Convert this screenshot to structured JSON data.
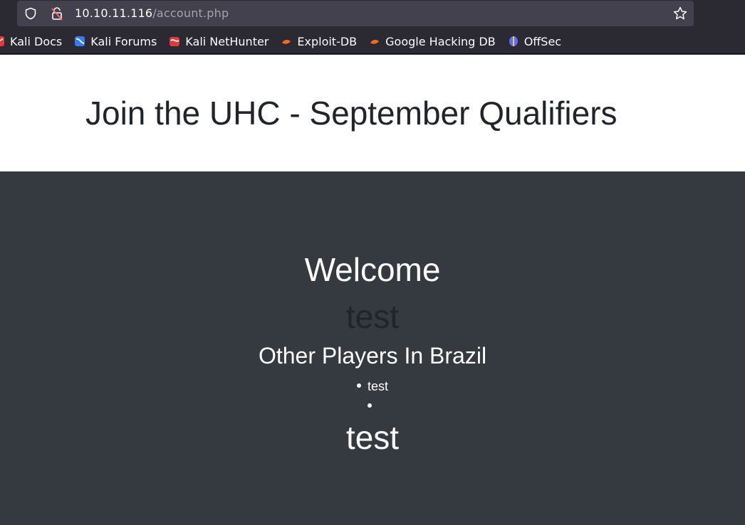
{
  "browser": {
    "url_host": "10.10.11.116",
    "url_path": "/account.php",
    "bookmarks": [
      {
        "label": "Kali Docs",
        "icon": "kali-docs-icon",
        "color": "#e23b3b"
      },
      {
        "label": "Kali Forums",
        "icon": "kali-forums-icon",
        "color": "#367bf0"
      },
      {
        "label": "Kali NetHunter",
        "icon": "kali-nethunter-icon",
        "color": "#e23b3b"
      },
      {
        "label": "Exploit-DB",
        "icon": "exploit-db-icon",
        "color": "#f26b21"
      },
      {
        "label": "Google Hacking DB",
        "icon": "google-hacking-db-icon",
        "color": "#f26b21"
      },
      {
        "label": "OffSec",
        "icon": "offsec-icon",
        "color": "#5b6cff"
      }
    ]
  },
  "page": {
    "header_title": "Join the UHC - September Qualifiers",
    "welcome": "Welcome",
    "username": "test",
    "players_title": "Other Players In Brazil",
    "players": [
      "test",
      ""
    ],
    "trailing_text": "test"
  },
  "colors": {
    "header_bg": "#ffffff",
    "main_bg": "#353a40",
    "title_text": "#212529"
  }
}
